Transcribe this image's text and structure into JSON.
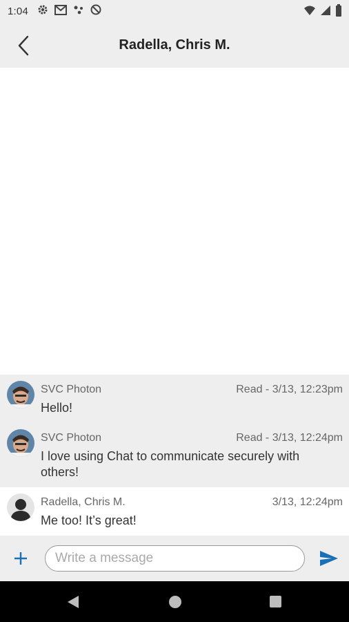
{
  "status_bar": {
    "time": "1:04",
    "icons_left": [
      "gear-icon",
      "mail-icon",
      "assistant-dots-icon",
      "no-disturb-icon"
    ],
    "icons_right": [
      "wifi-icon",
      "cell-signal-icon",
      "battery-icon"
    ]
  },
  "header": {
    "title": "Radella, Chris M.",
    "back_icon": "chevron-left-icon"
  },
  "messages": [
    {
      "sender": "SVC Photon",
      "meta": "Read - 3/13, 12:23pm",
      "text": "Hello!",
      "avatar": "photo-avatar"
    },
    {
      "sender": "SVC Photon",
      "meta": "Read - 3/13, 12:24pm",
      "text": "I love using Chat to communicate securely with others!",
      "avatar": "photo-avatar"
    },
    {
      "sender": "Radella, Chris M.",
      "meta": "3/13, 12:24pm",
      "text": "Me too!  It’s great!",
      "avatar": "silhouette-avatar"
    }
  ],
  "composer": {
    "placeholder": "Write a message",
    "value": "",
    "add_icon": "plus-icon",
    "send_icon": "send-icon"
  },
  "nav_bar": {
    "icons": [
      "back-triangle-icon",
      "home-circle-icon",
      "recents-square-icon"
    ]
  },
  "colors": {
    "accent": "#1a6fb5",
    "header_bg": "#eeeeee",
    "nav_bg": "#000000"
  }
}
